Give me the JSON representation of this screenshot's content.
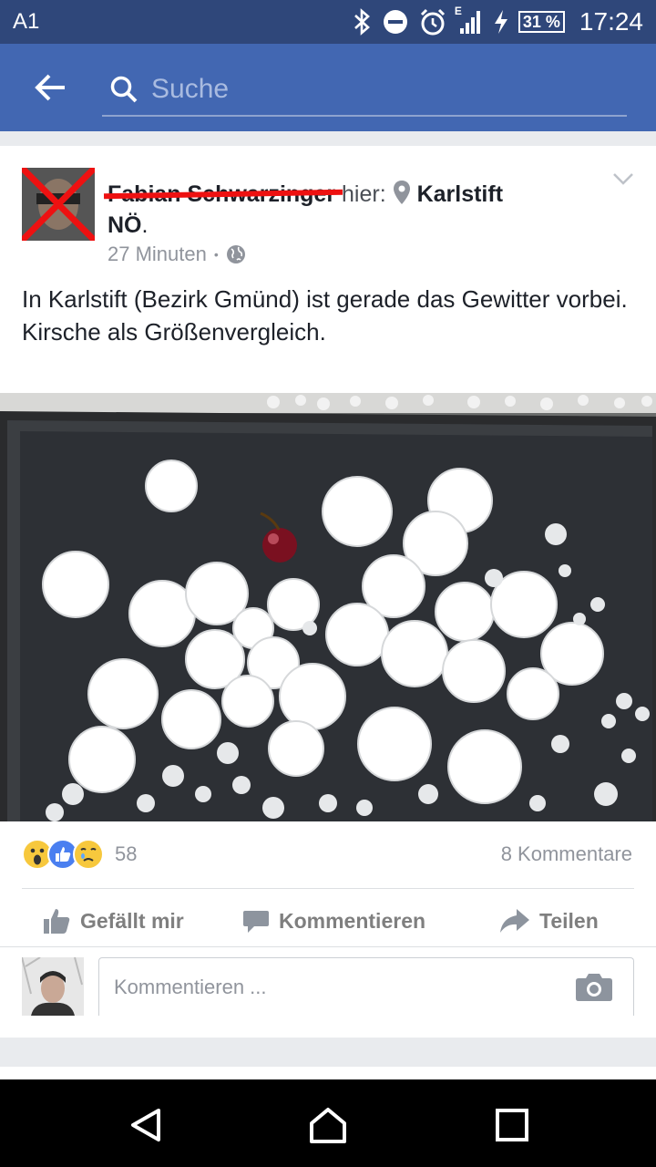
{
  "status_bar": {
    "carrier": "A1",
    "network_label": "E",
    "battery": "31 %",
    "time": "17:24"
  },
  "app_bar": {
    "search_placeholder": "Suche"
  },
  "post": {
    "author_redacted": "Fabian Schwarzinger",
    "here_label": "hier:",
    "place_name": "Karlstift",
    "place_region": "NÖ",
    "place_suffix": ".",
    "time_ago": "27 Minuten",
    "meta_separator": "•",
    "text_lines": [
      "In Karlstift (Bezirk Gmünd) ist gerade das Gewitter vorbei.",
      "Kirsche als Größenvergleich."
    ],
    "reaction_count": "58",
    "comment_count": "8 Kommentare",
    "actions": {
      "like": "Gefällt mir",
      "comment": "Kommentieren",
      "share": "Teilen"
    },
    "comment_placeholder": "Kommentieren ..."
  },
  "colors": {
    "status_bar": "#2f477a",
    "app_bar": "#4267b2",
    "like_blue": "#4a7ff0",
    "reaction_yellow": "#f7c83d",
    "redaction_red": "#e11111"
  },
  "icons": [
    "back-arrow-icon",
    "search-icon",
    "bluetooth-icon",
    "dnd-icon",
    "alarm-icon",
    "signal-icon",
    "charging-icon",
    "location-pin-icon",
    "globe-icon",
    "chevron-down-icon",
    "wow-reaction-icon",
    "like-reaction-icon",
    "sad-reaction-icon",
    "like-icon",
    "comment-icon",
    "share-icon",
    "camera-icon",
    "nav-back-icon",
    "nav-home-icon",
    "nav-recents-icon"
  ]
}
